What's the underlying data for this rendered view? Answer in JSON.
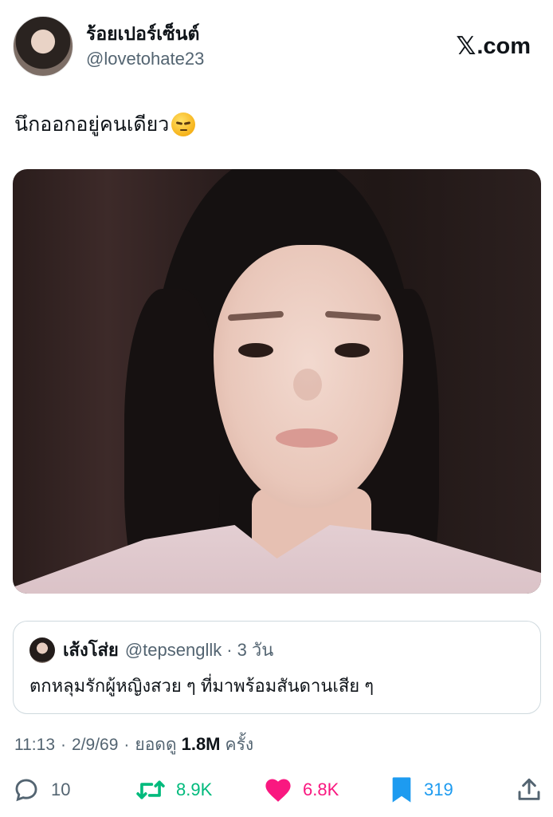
{
  "author": {
    "display_name": "ร้อยเปอร์เซ็นต์",
    "handle": "@lovetohate23"
  },
  "brand": {
    "mark": "𝕏",
    "suffix": ".com"
  },
  "tweet": {
    "text": "นึกออกอยู่คนเดียว",
    "emoji": "pensive-face-emoji"
  },
  "quote": {
    "display_name": "เส้งโส่ย",
    "handle": "@tepsengllk",
    "separator": "·",
    "time": "3 วัน",
    "text": "ตกหลุมรักผู้หญิงสวย ๆ ที่มาพร้อมสันดานเสีย ๆ"
  },
  "meta": {
    "time": "11:13",
    "date": "2/9/69",
    "views_prefix": "ยอดดู",
    "views": "1.8M",
    "views_suffix": "ครั้ง",
    "separator": "·"
  },
  "actions": {
    "replies": "10",
    "retweets": "8.9K",
    "likes": "6.8K",
    "bookmarks": "319"
  },
  "colors": {
    "text_primary": "#0f1419",
    "text_secondary": "#536471",
    "retweet_green": "#00ba7c",
    "like_pink": "#f91880",
    "bookmark_blue": "#1d9bf0",
    "border": "#cfd9de"
  },
  "icons": [
    "reply-icon",
    "retweet-icon",
    "heart-icon",
    "bookmark-icon",
    "share-icon"
  ]
}
